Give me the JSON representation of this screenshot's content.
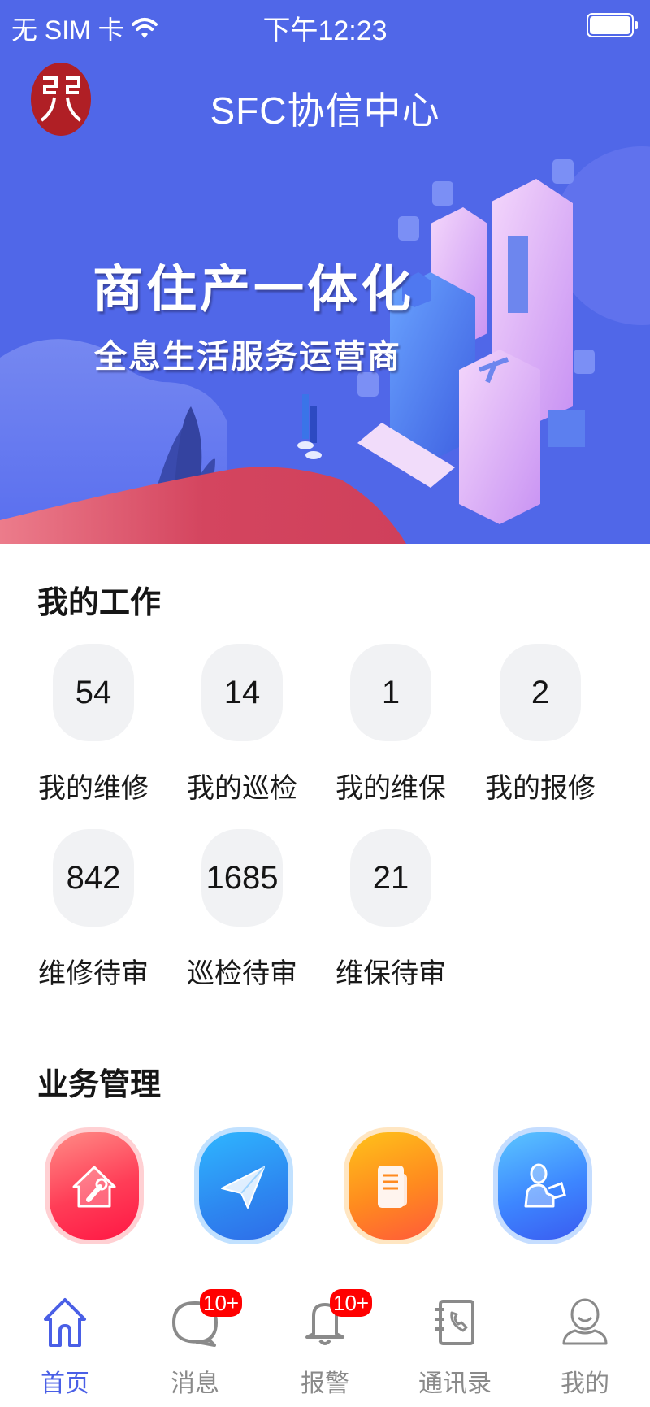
{
  "status_bar": {
    "carrier": "无 SIM 卡",
    "time": "下午12:23",
    "wifi_icon": "wifi-icon",
    "battery_icon": "battery-full-icon"
  },
  "header": {
    "title": "SFC协信中心",
    "logo_icon": "company-logo",
    "logo_color": "#b01f25"
  },
  "banner": {
    "headline": "商住产一体化",
    "subline": "全息生活服务运营商",
    "background_color": "#5067e8",
    "accent_hill_color": "#d4455f"
  },
  "my_work": {
    "title": "我的工作",
    "items": [
      {
        "count": "54",
        "label": "我的维修"
      },
      {
        "count": "14",
        "label": "我的巡检"
      },
      {
        "count": "1",
        "label": "我的维保"
      },
      {
        "count": "2",
        "label": "我的报修"
      },
      {
        "count": "842",
        "label": "维修待审"
      },
      {
        "count": "1685",
        "label": "巡检待审"
      },
      {
        "count": "21",
        "label": "维保待审"
      }
    ]
  },
  "business": {
    "title": "业务管理",
    "items": [
      {
        "icon": "house-wrench-icon",
        "color": "#ff3d57"
      },
      {
        "icon": "paper-plane-icon",
        "color": "#2d87f0"
      },
      {
        "icon": "document-icon",
        "color": "#ff8a1f"
      },
      {
        "icon": "person-clipboard-icon",
        "color": "#3d86ff"
      }
    ]
  },
  "tab_bar": {
    "active_color": "#4a5fe6",
    "inactive_color": "#8a8a8a",
    "tabs": [
      {
        "label": "首页",
        "icon": "home-icon",
        "active": true,
        "badge": ""
      },
      {
        "label": "消息",
        "icon": "message-bubble-icon",
        "active": false,
        "badge": "10+"
      },
      {
        "label": "报警",
        "icon": "bell-icon",
        "active": false,
        "badge": "10+"
      },
      {
        "label": "通讯录",
        "icon": "contacts-book-icon",
        "active": false,
        "badge": ""
      },
      {
        "label": "我的",
        "icon": "user-profile-icon",
        "active": false,
        "badge": ""
      }
    ]
  }
}
